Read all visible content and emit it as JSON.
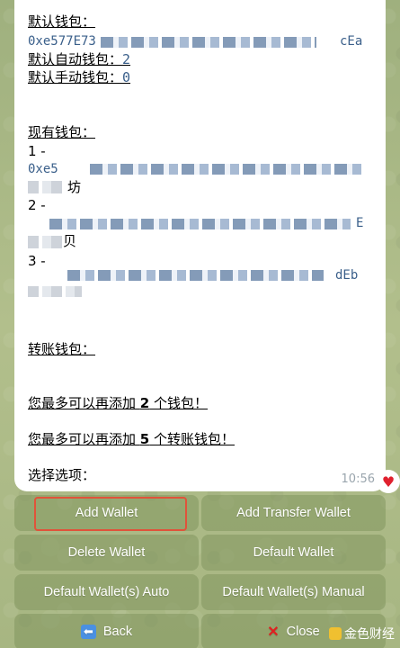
{
  "message": {
    "default_wallet_label": "默认钱包：",
    "default_wallet_addr_start": "0xe577E73",
    "default_wallet_addr_end": "cEa",
    "default_auto_label": "默认自动钱包：",
    "default_auto_value": "2",
    "default_manual_label": "默认手动钱包：",
    "default_manual_value": "0",
    "existing_wallets_label": "现有钱包：",
    "wallet1_index": "1 -",
    "wallet1_addr_start": "0xe5",
    "wallet1_name_suffix": "坊",
    "wallet2_index": "2 -",
    "wallet2_addr_end": "E",
    "wallet2_name_suffix": "贝",
    "wallet3_index": "3 -",
    "wallet3_addr_end": "dEb",
    "transfer_wallet_label": "转账钱包：",
    "can_add_wallets_prefix": "您最多可以再添加 ",
    "can_add_wallets_count": "2",
    "can_add_wallets_suffix": " 个钱包！",
    "can_add_transfer_prefix": "您最多可以再添加 ",
    "can_add_transfer_count": "5",
    "can_add_transfer_suffix": " 个转账钱包！",
    "choose_option": "选择选项：",
    "timestamp": "10:56"
  },
  "keyboard": {
    "add_wallet": "Add Wallet",
    "add_transfer_wallet": "Add Transfer Wallet",
    "delete_wallet": "Delete Wallet",
    "default_wallet": "Default Wallet",
    "default_wallet_auto": "Default Wallet(s) Auto",
    "default_wallet_manual": "Default Wallet(s) Manual",
    "back": "Back",
    "close": "Close"
  },
  "watermark": "金色财经",
  "colors": {
    "highlight": "#e0533a",
    "heart": "#e0202e",
    "address": "#3a5f8a"
  }
}
